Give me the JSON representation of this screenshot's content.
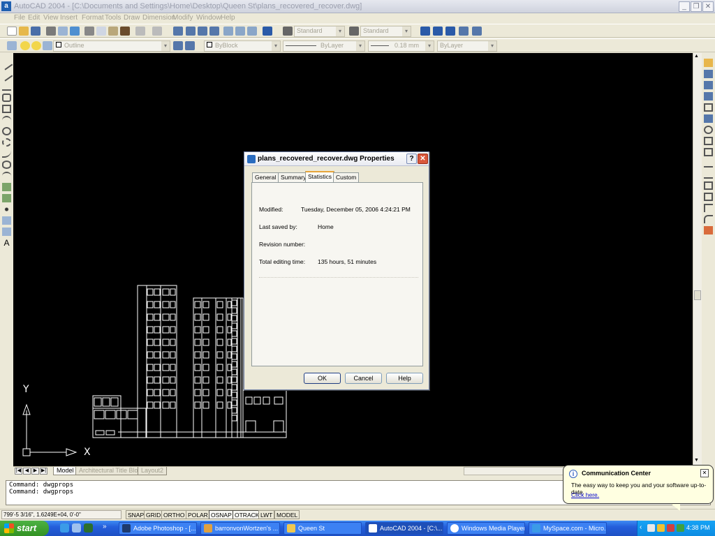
{
  "window": {
    "title": "AutoCAD 2004 - [C:\\Documents and Settings\\Home\\Desktop\\Queen St\\plans_recovered_recover.dwg]",
    "app_icon": "a"
  },
  "menu": [
    "File",
    "Edit",
    "View",
    "Insert",
    "Format",
    "Tools",
    "Draw",
    "Dimension",
    "Modify",
    "Window",
    "Help"
  ],
  "toolbar": {
    "text_style": "Standard",
    "dim_style": "Standard",
    "layer": "Outline",
    "color": "ByBlock",
    "linetype": "ByLayer",
    "lineweight": "0.18 mm",
    "plot_style": "ByLayer"
  },
  "ucs": {
    "x_label": "X",
    "y_label": "Y"
  },
  "layout_tabs": [
    "Model",
    "Architectural Title Block",
    "Layout2"
  ],
  "command_lines": [
    "Command: dwgprops",
    "Command: dwgprops"
  ],
  "status": {
    "coordinates": "799'-5 3/16\", 1.6249E+04, 0'-0\"",
    "toggles": [
      "SNAP",
      "GRID",
      "ORTHO",
      "POLAR",
      "OSNAP",
      "OTRACK",
      "LWT",
      "MODEL"
    ]
  },
  "dialog": {
    "title": "plans_recovered_recover.dwg Properties",
    "help_button": "?",
    "close_button": "✕",
    "tabs": [
      "General",
      "Summary",
      "Statistics",
      "Custom"
    ],
    "active_tab": "Statistics",
    "properties": [
      {
        "label": "Modified:",
        "value": "Tuesday, December 05, 2006  4:24:21 PM"
      },
      {
        "label": "Last saved by:",
        "value": "Home"
      },
      {
        "label": "Revision number:",
        "value": ""
      },
      {
        "label": "Total editing time:",
        "value": "135 hours, 51 minutes"
      }
    ],
    "buttons": {
      "ok": "OK",
      "cancel": "Cancel",
      "help": "Help"
    }
  },
  "balloon": {
    "title": "Communication Center",
    "message": "The easy way to keep you and your software up-to-date.",
    "link": "Click here.",
    "close": "✕",
    "info_glyph": "i"
  },
  "taskbar": {
    "start": "start",
    "tasks": [
      "Adobe Photoshop - [...",
      "barronvonWortzen's ...",
      "Queen St",
      "AutoCAD 2004 - [C:\\...",
      "Windows Media Player",
      "MySpace.com - Micro..."
    ],
    "active_task": "AutoCAD 2004 - [C:\\...",
    "clock": "4:38 PM"
  }
}
